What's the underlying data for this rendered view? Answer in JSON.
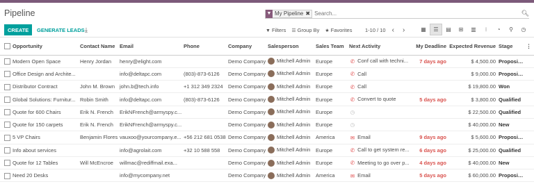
{
  "page": {
    "title": "Pipeline"
  },
  "search": {
    "facet_label": "My Pipeline",
    "placeholder": "Search..."
  },
  "toolbar": {
    "create_label": "CREATE",
    "generate_label": "GENERATE LEADS",
    "filters_label": "Filters",
    "groupby_label": "Group By",
    "favorites_label": "Favorites"
  },
  "pager": {
    "text": "1-10 / 10"
  },
  "views": [
    "kanban-icon",
    "list-icon",
    "calendar-icon",
    "pivot-icon",
    "graph-icon",
    "cohort-icon",
    "dashboard-icon",
    "map-icon",
    "activity-icon"
  ],
  "columns": [
    "Opportunity",
    "Contact Name",
    "Email",
    "Phone",
    "Company",
    "Salesperson",
    "Sales Team",
    "Next Activity",
    "My Deadline",
    "Expected Revenue",
    "Stage"
  ],
  "rows": [
    {
      "opportunity": "Modern Open Space",
      "contact": "Henry Jordan",
      "email": "henry@elight.com",
      "phone": "",
      "company": "Demo Company",
      "salesperson": "Mitchell Admin",
      "team": "Europe",
      "activity_icon": "phone",
      "activity": "Conf call with techni...",
      "deadline": "7 days ago",
      "revenue": "$ 4,500.00",
      "stage": "Proposition"
    },
    {
      "opportunity": "Office Design and Archite...",
      "contact": "",
      "email": "info@deltapc.com",
      "phone": "(803)-873-6126",
      "company": "Demo Company",
      "salesperson": "Mitchell Admin",
      "team": "Europe",
      "activity_icon": "phone",
      "activity": "Call",
      "deadline": "",
      "revenue": "$ 9,000.00",
      "stage": "Proposition"
    },
    {
      "opportunity": "Distributor Contract",
      "contact": "John M. Brown",
      "email": "john.b@tech.info",
      "phone": "+1 312 349 2324",
      "company": "Demo Company",
      "salesperson": "Mitchell Admin",
      "team": "Europe",
      "activity_icon": "phone",
      "activity": "Call",
      "deadline": "",
      "revenue": "$ 19,800.00",
      "stage": "Won"
    },
    {
      "opportunity": "Global Solutions: Furnitur...",
      "contact": "Robin Smith",
      "email": "info@deltapc.com",
      "phone": "(803)-873-6126",
      "company": "Demo Company",
      "salesperson": "Mitchell Admin",
      "team": "Europe",
      "activity_icon": "phone",
      "activity": "Convert to quote",
      "deadline": "5 days ago",
      "revenue": "$ 3,800.00",
      "stage": "Qualified"
    },
    {
      "opportunity": "Quote for 600 Chairs",
      "contact": "Erik N. French",
      "email": "ErikNFrench@armyspy.c...",
      "phone": "",
      "company": "Demo Company",
      "salesperson": "Mitchell Admin",
      "team": "Europe",
      "activity_icon": "clock",
      "activity": "",
      "deadline": "",
      "revenue": "$ 22,500.00",
      "stage": "Qualified"
    },
    {
      "opportunity": "Quote for 150 carpets",
      "contact": "Erik N. French",
      "email": "ErikNFrench@armyspy.c...",
      "phone": "",
      "company": "Demo Company",
      "salesperson": "Mitchell Admin",
      "team": "Europe",
      "activity_icon": "clock",
      "activity": "",
      "deadline": "",
      "revenue": "$ 40,000.00",
      "stage": "New"
    },
    {
      "opportunity": "5 VP Chairs",
      "contact": "Benjamin Flores",
      "email": "vauxoo@yourcompany.e...",
      "phone": "+56 212 681 0538",
      "company": "Demo Company",
      "salesperson": "Mitchell Admin",
      "team": "America",
      "activity_icon": "email",
      "activity": "Email",
      "deadline": "9 days ago",
      "revenue": "$ 5,600.00",
      "stage": "Proposition"
    },
    {
      "opportunity": "Info about services",
      "contact": "",
      "email": "info@agrolait.com",
      "phone": "+32 10 588 558",
      "company": "Demo Company",
      "salesperson": "Mitchell Admin",
      "team": "Europe",
      "activity_icon": "phone",
      "activity": "Call to get system re...",
      "deadline": "6 days ago",
      "revenue": "$ 25,000.00",
      "stage": "Qualified"
    },
    {
      "opportunity": "Quote for 12 Tables",
      "contact": "Will McEncroe",
      "email": "willmac@rediffmail.exa...",
      "phone": "",
      "company": "Demo Company",
      "salesperson": "Mitchell Admin",
      "team": "Europe",
      "activity_icon": "phone",
      "activity": "Meeting to go over p...",
      "deadline": "4 days ago",
      "revenue": "$ 40,000.00",
      "stage": "New"
    },
    {
      "opportunity": "Need 20 Desks",
      "contact": "",
      "email": "info@mycompany.net",
      "phone": "",
      "company": "Demo Company",
      "salesperson": "Mitchell Admin",
      "team": "America",
      "activity_icon": "email",
      "activity": "Email",
      "deadline": "5 days ago",
      "revenue": "$ 60,000.00",
      "stage": "Proposition"
    }
  ],
  "colors": {
    "brand": "#7c5a7a",
    "accent": "#00a09d",
    "overdue": "#d9534f",
    "activity_icon": "#e04848"
  }
}
